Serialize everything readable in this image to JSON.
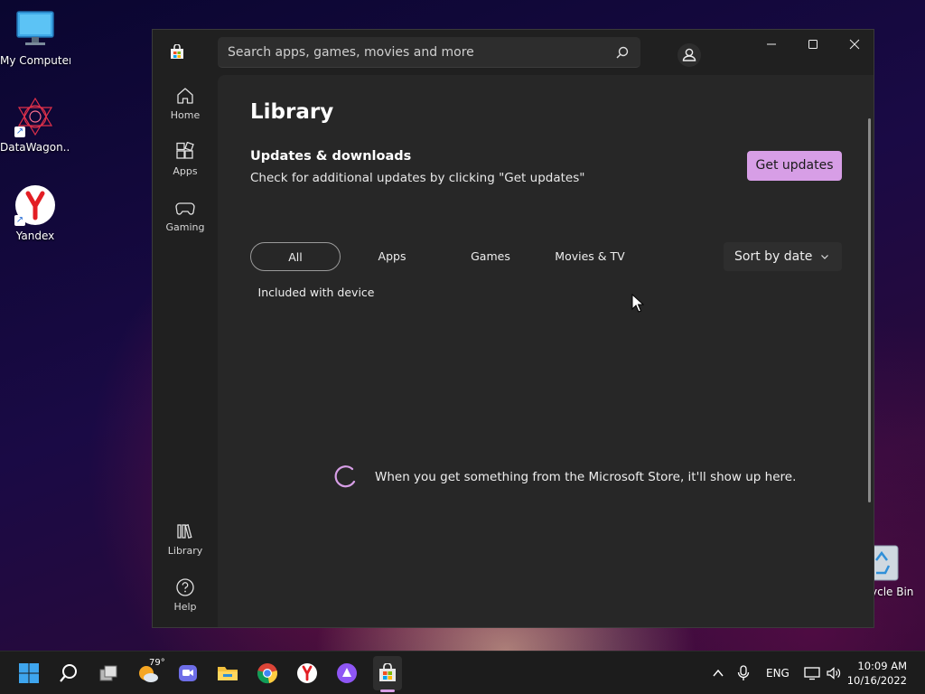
{
  "desktop": {
    "icons": [
      {
        "label": "My Computer"
      },
      {
        "label": "DataWagon..."
      },
      {
        "label": "Yandex"
      }
    ],
    "recycle_bin_label": "ycle Bin"
  },
  "window": {
    "search_placeholder": "Search apps, games, movies and more",
    "nav": {
      "home": "Home",
      "apps": "Apps",
      "gaming": "Gaming",
      "library": "Library",
      "help": "Help"
    },
    "page_title": "Library",
    "section_title": "Updates & downloads",
    "section_desc": "Check for additional updates by clicking \"Get updates\"",
    "get_updates": "Get updates",
    "filters": [
      "All",
      "Apps",
      "Games",
      "Movies & TV",
      "Included with device"
    ],
    "sort_label": "Sort by date",
    "empty_message": "When you get something from the Microsoft Store, it'll show up here."
  },
  "taskbar": {
    "weather_temp": "79°",
    "language": "ENG",
    "time": "10:09 AM",
    "date": "10/16/2022"
  },
  "colors": {
    "accent": "#d79ee6",
    "window_bg": "#202020",
    "content_bg": "#272727"
  }
}
